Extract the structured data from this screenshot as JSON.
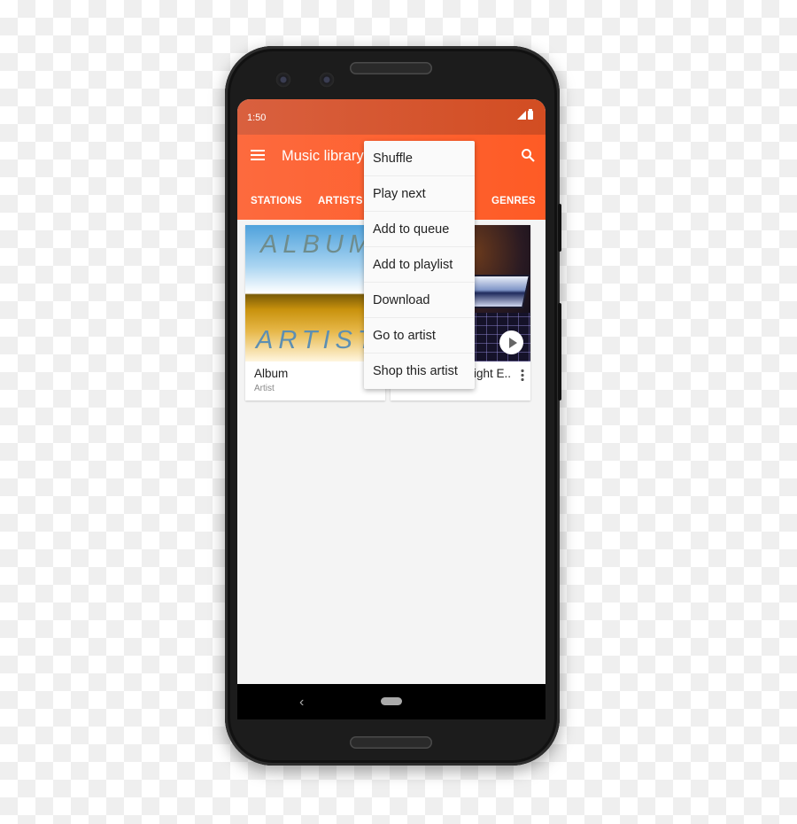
{
  "status_bar": {
    "time": "1:50",
    "icons": [
      "signal-icon",
      "battery-icon"
    ]
  },
  "app_bar": {
    "title": "Music library",
    "menu_icon": "hamburger-menu-icon",
    "search_icon": "search-icon",
    "tabs": [
      {
        "label": "STATIONS"
      },
      {
        "label": "ARTISTS"
      },
      {
        "label": "GENRES"
      }
    ]
  },
  "cards": [
    {
      "title": "Album",
      "subtitle": "Artist",
      "art_text_top": "ALBUM",
      "art_text_bottom": "ARTIST"
    },
    {
      "title": "Night E..",
      "subtitle": ""
    }
  ],
  "context_menu": {
    "items": [
      {
        "label": "Shuffle"
      },
      {
        "label": "Play next"
      },
      {
        "label": "Add to queue"
      },
      {
        "label": "Add to playlist"
      },
      {
        "label": "Download"
      },
      {
        "label": "Go to artist"
      },
      {
        "label": "Shop this artist"
      }
    ]
  },
  "nav_bar": {
    "back": "‹"
  },
  "colors": {
    "accent": "#fe6232",
    "status_bar": "#d5552e"
  }
}
